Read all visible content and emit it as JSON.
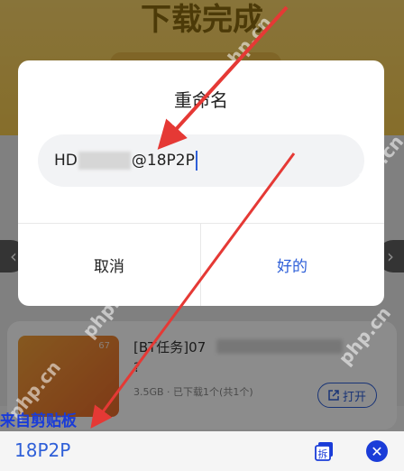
{
  "background": {
    "title": "下载完成",
    "task": {
      "name": "[BT任务]07",
      "line2": "?",
      "meta": "3.5GB · 已下载1个(共1个)",
      "open_label": "打开",
      "thumb_number": "67"
    }
  },
  "dialog": {
    "title": "重命名",
    "input_prefix": "HD",
    "input_suffix": "@18P2P",
    "cancel_label": "取消",
    "ok_label": "好的"
  },
  "clipboard": {
    "label": "来自剪贴板",
    "text": "18P2P",
    "split_label": "拆"
  },
  "watermark": "php.cn",
  "colors": {
    "accent": "#2e5fd8",
    "annotation_arrow": "#e53935",
    "header_yellow": "#f5c84e"
  }
}
